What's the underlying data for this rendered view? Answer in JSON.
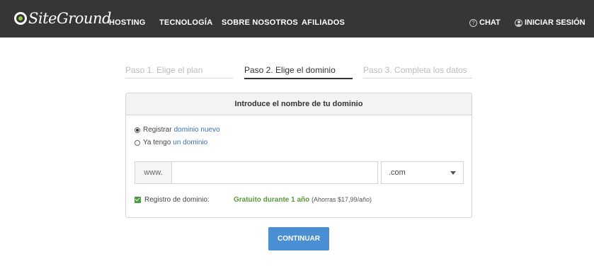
{
  "header": {
    "logo_text": "SiteGround",
    "nav": [
      "HOSTING",
      "TECNOLOGÍA",
      "SOBRE NOSOTROS",
      "AFILIADOS"
    ],
    "chat_label": "CHAT",
    "chat_icon": "?",
    "login_label": "INICIAR SESIÓN"
  },
  "steps": [
    {
      "label": "Paso 1. Elige el plan",
      "state": "inactive"
    },
    {
      "label": "Paso 2. Elige el dominio",
      "state": "active"
    },
    {
      "label": "Paso 3. Completa los datos",
      "state": "inactive"
    }
  ],
  "panel": {
    "title": "Introduce el nombre de tu dominio",
    "option_register": {
      "text": "Registrar",
      "link": "dominio nuevo",
      "selected": true
    },
    "option_existing": {
      "text": "Ya tengo",
      "link": "un dominio",
      "selected": false
    },
    "www_prefix": "www.",
    "domain_value": "",
    "domain_placeholder": "",
    "tld_selected": ".com",
    "registration_label": "Registro de dominio:",
    "registration_checked": true,
    "free_text": "Gratuito durante 1 año",
    "savings_text": "(Ahorras $17,99/año)"
  },
  "continue_label": "CONTINUAR",
  "colors": {
    "header_bg": "#363636",
    "logo_accent": "#8dc63f",
    "link": "#3a6fb5",
    "success": "#5b9a3a",
    "button": "#4a8fd4"
  }
}
